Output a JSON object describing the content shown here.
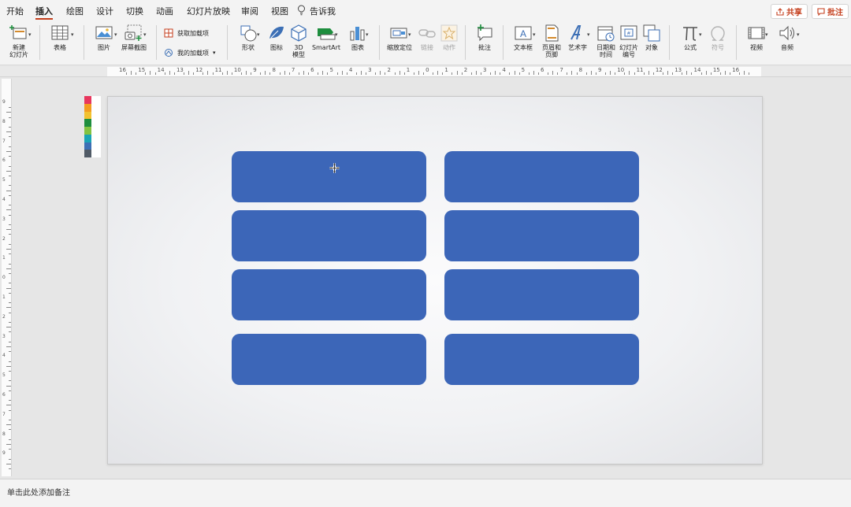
{
  "menu": {
    "tabs": [
      "开始",
      "插入",
      "绘图",
      "设计",
      "切换",
      "动画",
      "幻灯片放映",
      "审阅",
      "视图"
    ],
    "active_tab": "插入",
    "tell_me": "告诉我",
    "share": "共享",
    "comments": "批注"
  },
  "ribbon": {
    "new_slide": "新建\n幻灯片",
    "table": "表格",
    "pictures": "图片",
    "screenshot": "屏幕截图",
    "get_addins": "获取加载项",
    "my_addins": "我的加载项",
    "shapes": "形状",
    "icons": "图标",
    "models_3d": "3D\n模型",
    "smartart": "SmartArt",
    "chart": "图表",
    "zoom": "缩放定位",
    "link": "链接",
    "action": "动作",
    "comment": "批注",
    "text_box": "文本框",
    "header_footer": "页眉和\n页脚",
    "wordart": "艺术字",
    "date_time": "日期和\n时间",
    "slide_number": "幻灯片\n编号",
    "object": "对象",
    "equation": "公式",
    "symbol": "符号",
    "video": "视频",
    "audio": "音频"
  },
  "ruler": {
    "horizontal_labels": [
      "16",
      "15",
      "14",
      "13",
      "12",
      "11",
      "10",
      "9",
      "8",
      "7",
      "6",
      "5",
      "4",
      "3",
      "2",
      "1",
      "0",
      "1",
      "2",
      "3",
      "4",
      "5",
      "6",
      "7",
      "8",
      "9",
      "10",
      "11",
      "12",
      "13",
      "14",
      "15",
      "16"
    ],
    "vertical_labels": [
      "9",
      "8",
      "7",
      "6",
      "5",
      "4",
      "3",
      "2",
      "1",
      "0",
      "1",
      "2",
      "3",
      "4",
      "5",
      "6",
      "7",
      "8",
      "9"
    ]
  },
  "palette_colors": [
    "#e8365d",
    "#f39c1f",
    "#f2c230",
    "#1e8e3e",
    "#83c341",
    "#1aa5b5",
    "#3c6fb5",
    "#505a66"
  ],
  "slide": {
    "shape_color": "#3c66b8",
    "shape_count": 8
  },
  "accent_color": "#c43e1c",
  "notes_placeholder": "单击此处添加备注"
}
